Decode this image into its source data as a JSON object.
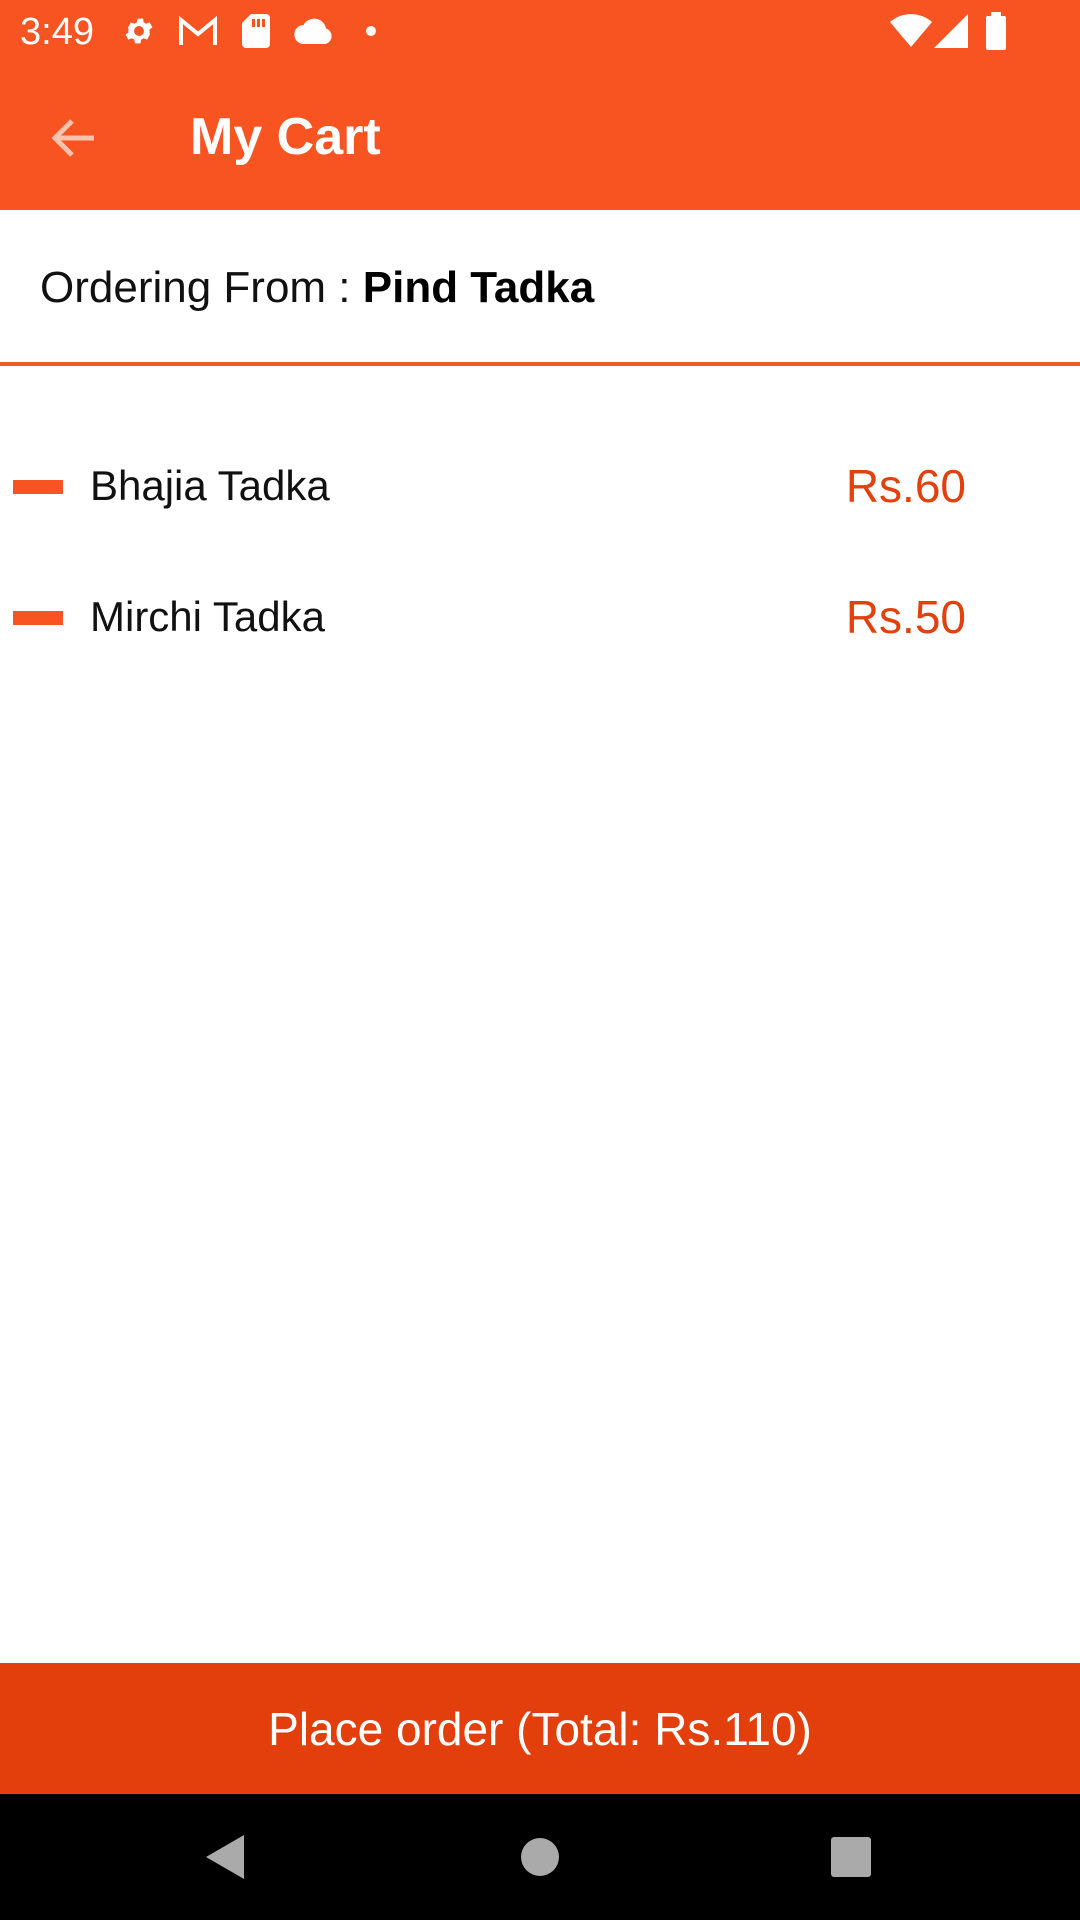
{
  "status_bar": {
    "time": "3:49",
    "left_icons": [
      "gear-icon",
      "gmail-icon",
      "sd-card-icon",
      "cloud-icon",
      "dot-icon"
    ],
    "right_icons": [
      "wifi-icon",
      "signal-icon",
      "battery-icon"
    ]
  },
  "app_bar": {
    "title": "My Cart",
    "back_icon": "arrow-left-icon",
    "color": "#f75422"
  },
  "ordering_from": {
    "label": "Ordering From : ",
    "restaurant": "Pind Tadka"
  },
  "cart": {
    "items": [
      {
        "name": "Bhajia Tadka",
        "price": "Rs.60"
      },
      {
        "name": "Mirchi Tadka",
        "price": "Rs.50"
      }
    ]
  },
  "place_order": {
    "label": "Place order (Total: Rs.110)",
    "color": "#e23f0c"
  },
  "nav_bar": {
    "buttons": [
      "back-triangle-icon",
      "home-circle-icon",
      "recents-square-icon"
    ]
  }
}
